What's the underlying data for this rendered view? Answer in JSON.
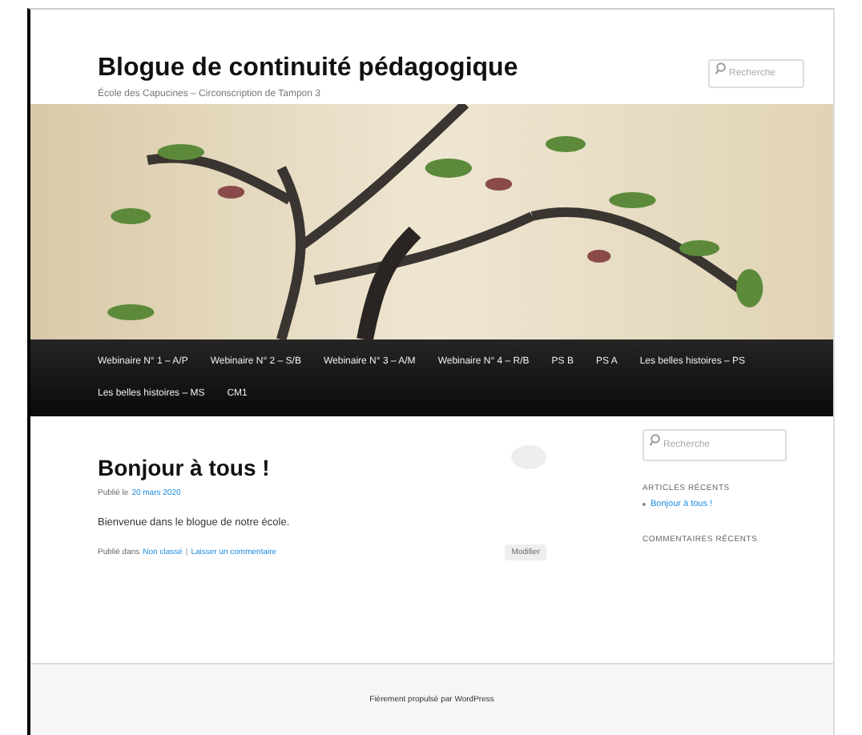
{
  "site": {
    "title": "Blogue de continuité pédagogique",
    "tagline": "École des Capucines – Circonscription de Tampon 3",
    "search": {
      "placeholder": "Recherche"
    }
  },
  "menu": [
    {
      "label": "Webinaire N° 1 – A/P"
    },
    {
      "label": "Webinaire N° 2 – S/B"
    },
    {
      "label": "Webinaire N° 3 – A/M"
    },
    {
      "label": "Webinaire N° 4 – R/B"
    },
    {
      "label": "PS B"
    },
    {
      "label": "PS A"
    },
    {
      "label": "Les belles histoires – PS"
    },
    {
      "label": "Les belles histoires – MS"
    },
    {
      "label": "CM1"
    }
  ],
  "post": {
    "title": "Bonjour à tous !",
    "date_prefix": "Publié le",
    "date": "20 mars 2020",
    "body": "Bienvenue dans le blogue de notre école.",
    "category_prefix": "Publié dans",
    "category": "Non classé",
    "separator": "|",
    "comment_link": "Laisser un commentaire",
    "edit": "Modifier"
  },
  "sidebar": {
    "search": {
      "placeholder": "Recherche"
    },
    "recent_posts_heading": "ARTICLES RÉCENTS",
    "recent_posts": [
      "Bonjour à tous !"
    ],
    "recent_comments_heading": "COMMENTAIRES RÉCENTS"
  },
  "footer": "Fièrement propulsé par WordPress"
}
